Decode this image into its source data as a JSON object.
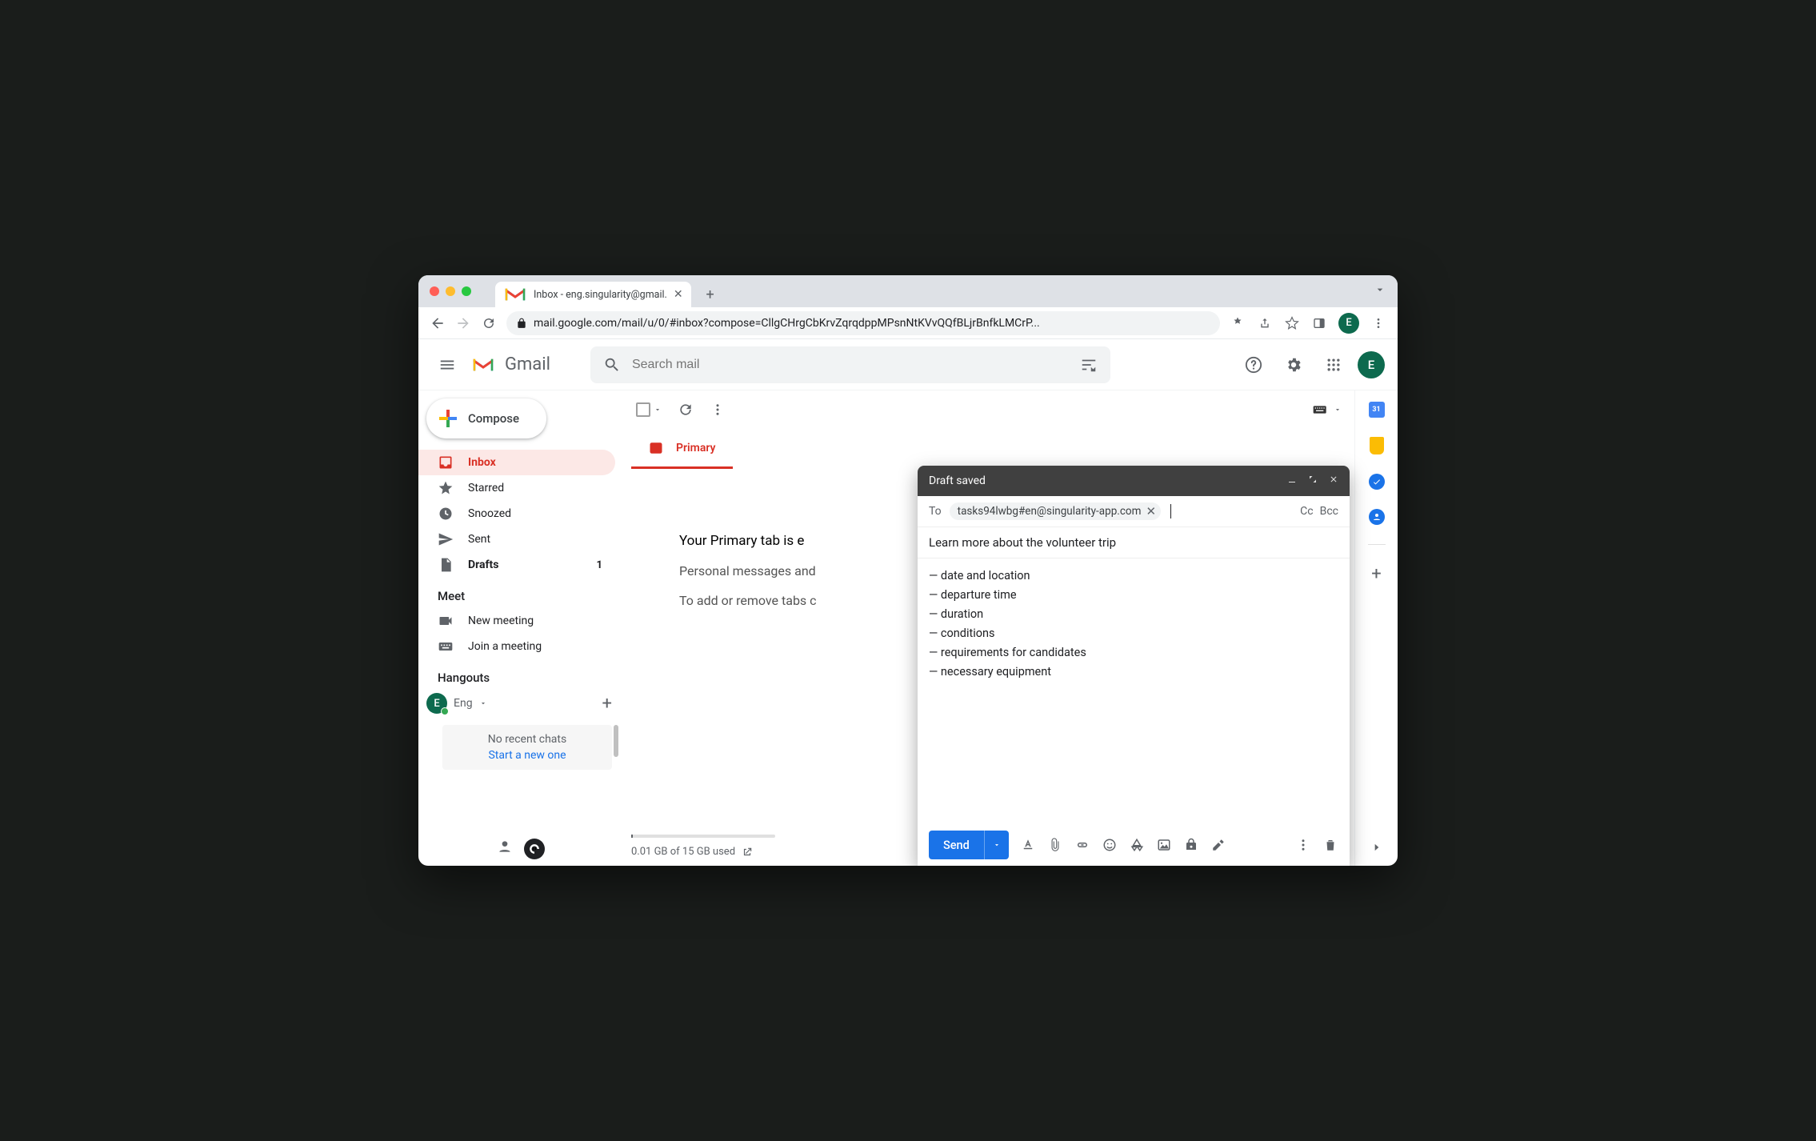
{
  "browser": {
    "tab_title": "Inbox - eng.singularity@gmail.",
    "url_display": "mail.google.com/mail/u/0/#inbox?compose=CllgCHrgCbKrvZqrqdppMPsnNtKVvQQfBLjrBnfkLMCrP...",
    "avatar_letter": "E"
  },
  "header": {
    "product": "Gmail",
    "search_placeholder": "Search mail",
    "avatar_letter": "E"
  },
  "sidebar": {
    "compose_label": "Compose",
    "items": [
      {
        "icon": "inbox",
        "label": "Inbox",
        "active": true,
        "bold": true,
        "count": ""
      },
      {
        "icon": "star",
        "label": "Starred"
      },
      {
        "icon": "clock",
        "label": "Snoozed"
      },
      {
        "icon": "send",
        "label": "Sent"
      },
      {
        "icon": "file",
        "label": "Drafts",
        "bold": true,
        "count": "1"
      }
    ],
    "meet_title": "Meet",
    "meet_items": [
      {
        "icon": "video",
        "label": "New meeting"
      },
      {
        "icon": "keyboard",
        "label": "Join a meeting"
      }
    ],
    "hangouts_title": "Hangouts",
    "hangouts_user_letter": "E",
    "hangouts_user_name": "Eng",
    "no_chats": "No recent chats",
    "start_new": "Start a new one"
  },
  "tabs": {
    "primary": "Primary"
  },
  "empty": {
    "heading": "Your Primary tab is e",
    "sub": "Personal messages and",
    "tip": "To add or remove tabs c"
  },
  "storage": "0.01 GB of 15 GB used",
  "right_rail": {
    "calendar_day": "31"
  },
  "compose": {
    "title": "Draft saved",
    "to_label": "To",
    "to_chip": "tasks94lwbg#en@singularity-app.com",
    "cc": "Cc",
    "bcc": "Bcc",
    "subject": "Learn more about the volunteer trip",
    "body_lines": [
      "— date and location",
      "— departure time",
      "— duration",
      "— conditions",
      "— requirements for candidates",
      "— necessary equipment"
    ],
    "send": "Send"
  }
}
